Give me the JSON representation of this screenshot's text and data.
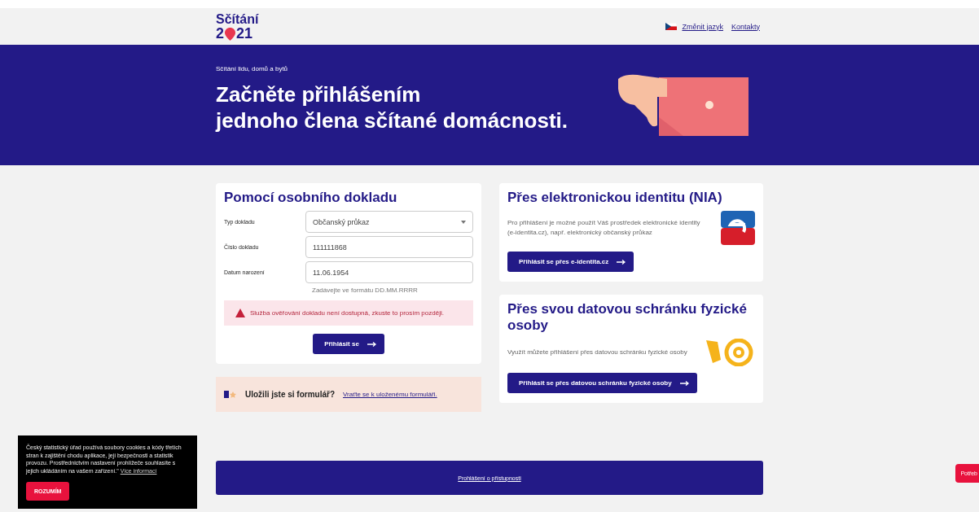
{
  "header": {
    "logo_title": "Sčítání",
    "logo_year_start": "2",
    "logo_year_end": "21",
    "links": [
      {
        "label": "Změnit jazyk",
        "kind": "language"
      },
      {
        "label": "Kontakty",
        "kind": "plain"
      }
    ]
  },
  "banner": {
    "eyebrow": "Sčítání lidu, domů a bytů",
    "title_lines": [
      "Začněte přihlášením",
      "jednoho člena sčítané domácnosti."
    ]
  },
  "document_form": {
    "title": "Pomocí osobního dokladu",
    "fields": [
      {
        "label": "Typ dokladu",
        "value": "Občanský průkaz",
        "kind": "select"
      },
      {
        "label": "Číslo dokladu",
        "value": "111111868",
        "kind": "text"
      },
      {
        "label": "Datum narození",
        "value": "11.06.1954",
        "kind": "text",
        "hint": "Zadávejte ve formátu DD.MM.RRRR"
      }
    ],
    "error": "Služba ověřování dokladu není dostupná, zkuste to prosím později.",
    "submit": "Přihlásit se"
  },
  "saved_form": {
    "question": "Uložili jste si formulář?",
    "link": "Vraťte se k uloženému formuláři."
  },
  "nia": {
    "title": "Přes elektronickou identitu (NIA)",
    "text": "Pro přihlášení je možné použít Váš prostředek elektronické identity (e-identita.cz), např. elektronický občanský průkaz",
    "button": "Přihlásit se přes e-identita.cz"
  },
  "databox": {
    "title": "Přes svou datovou schránku fyzické osoby",
    "text": "Využít můžete přihlášení přes datovou schránku fyzické osoby",
    "button": "Přihlásit se přes datovou schránku fyzické osoby"
  },
  "accessibility_link": "Prohlášení o přístupnosti",
  "cookie_notice": {
    "text": "Český statistický úřad používá soubory cookies a kódy třetích stran k zajištění chodu aplikace, její bezpečnosti a statistik provozu. Prostřednictvím nastavení prohlížeče souhlasíte s jejich ukládáním na vašem zařízení.\"",
    "link": "Více informací",
    "button": "ROZUMÍM"
  },
  "help_button": "Potřeb"
}
